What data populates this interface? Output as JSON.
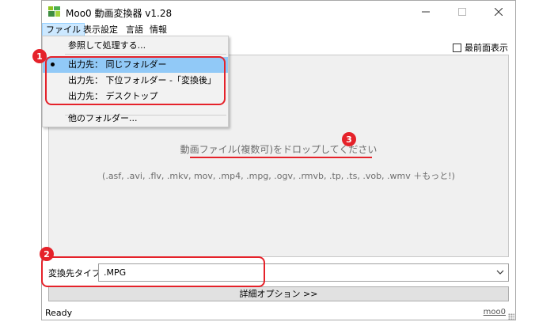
{
  "window": {
    "title": "Moo0 動画変換器 v1.28",
    "controls": {
      "minimize": "─",
      "maximize": "☐",
      "close": "✕"
    }
  },
  "menubar": {
    "items": [
      {
        "label": "ファイル",
        "active": true
      },
      {
        "label": "表示設定",
        "active": false
      },
      {
        "label": "言語",
        "active": false
      },
      {
        "label": "情報",
        "active": false
      }
    ]
  },
  "file_menu": {
    "browse": "参照して処理する...",
    "options": [
      {
        "label": "出力先： 同じフォルダー",
        "selected": true
      },
      {
        "label": "出力先： 下位フォルダー -「変換後」",
        "selected": false
      },
      {
        "label": "出力先： デスクトップ",
        "selected": false
      }
    ],
    "other_folder": "他のフォルダー..."
  },
  "topmost_checkbox": {
    "label": "最前面表示",
    "checked": false
  },
  "dropzone": {
    "main_text": "動画ファイル(複数可)をドロップしてください",
    "formats_text": "(.asf, .avi, .flv, .mkv, mov, .mp4, .mpg, .ogv, .rmvb, .tp, .ts, .vob, .wmv ＋もっと!)"
  },
  "output_type": {
    "label": "変換先タイプ:",
    "value": ".MPG"
  },
  "detail_button": {
    "label": "詳細オプション >>"
  },
  "statusbar": {
    "status": "Ready",
    "link": "moo0"
  },
  "annotations": {
    "badge_1": "1",
    "badge_2": "2",
    "badge_3": "3",
    "color": "#e5222a"
  },
  "colors": {
    "menu_highlight": "#91c9f7",
    "menu_active": "#cce8ff",
    "dropzone_bg": "#f0f0f0"
  }
}
